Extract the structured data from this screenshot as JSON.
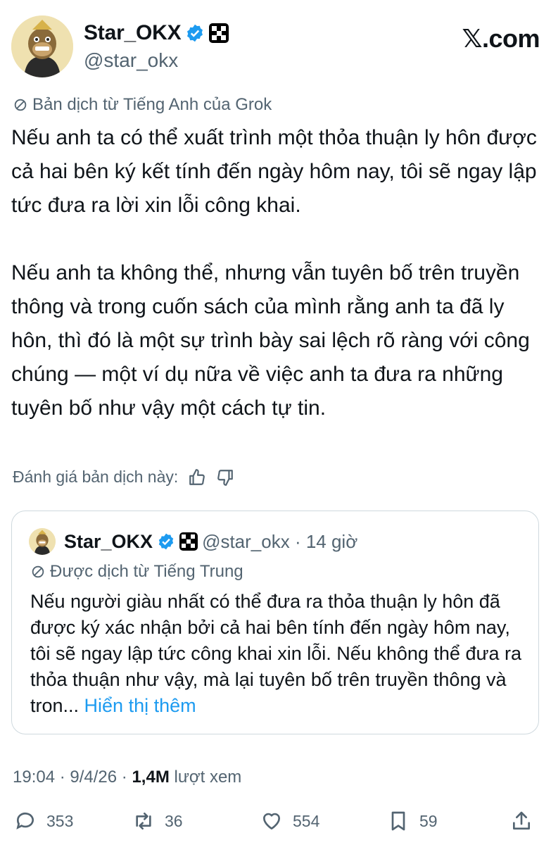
{
  "author": {
    "name": "Star_OKX",
    "handle": "@star_okx"
  },
  "site": "𝕏.com",
  "translation_note": "Bản dịch từ Tiếng Anh của Grok",
  "body": {
    "paragraph1": "Nếu anh ta có thể xuất trình một thỏa thuận ly hôn được cả hai bên ký kết tính đến ngày hôm nay, tôi sẽ ngay lập tức đưa ra lời xin lỗi công khai.",
    "paragraph2": "Nếu anh ta không thể, nhưng vẫn tuyên bố trên truyền thông và trong cuốn sách của mình rằng anh ta đã ly hôn, thì đó là một sự trình bày sai lệch rõ ràng với công chúng — một ví dụ nữa về việc anh ta đưa ra những tuyên bố như vậy một cách tự tin."
  },
  "rate_translation": "Đánh giá bản dịch này:",
  "quote": {
    "name": "Star_OKX",
    "handle_time": "@star_okx · 14 giờ",
    "translation_note": "Được dịch từ Tiếng Trung",
    "text": "Nếu người giàu nhất có thể đưa ra thỏa thuận ly hôn đã được ký xác nhận bởi cả hai bên tính đến ngày hôm nay, tôi sẽ ngay lập tức công khai xin lỗi. Nếu không thể đưa ra thỏa thuận như vậy, mà lại tuyên bố trên truyền thông và tron...",
    "show_more": "Hiển thị thêm"
  },
  "meta": {
    "time_date": "19:04 · 9/4/26 · ",
    "views": "1,4M",
    "views_label": "lượt xem"
  },
  "actions": {
    "replies": "353",
    "reposts": "36",
    "likes": "554",
    "bookmarks": "59"
  },
  "colors": {
    "text": "#0f1419",
    "secondary": "#536471",
    "link": "#1d9bf0",
    "verified": "#1d9bf0",
    "border": "#cfd9de"
  }
}
